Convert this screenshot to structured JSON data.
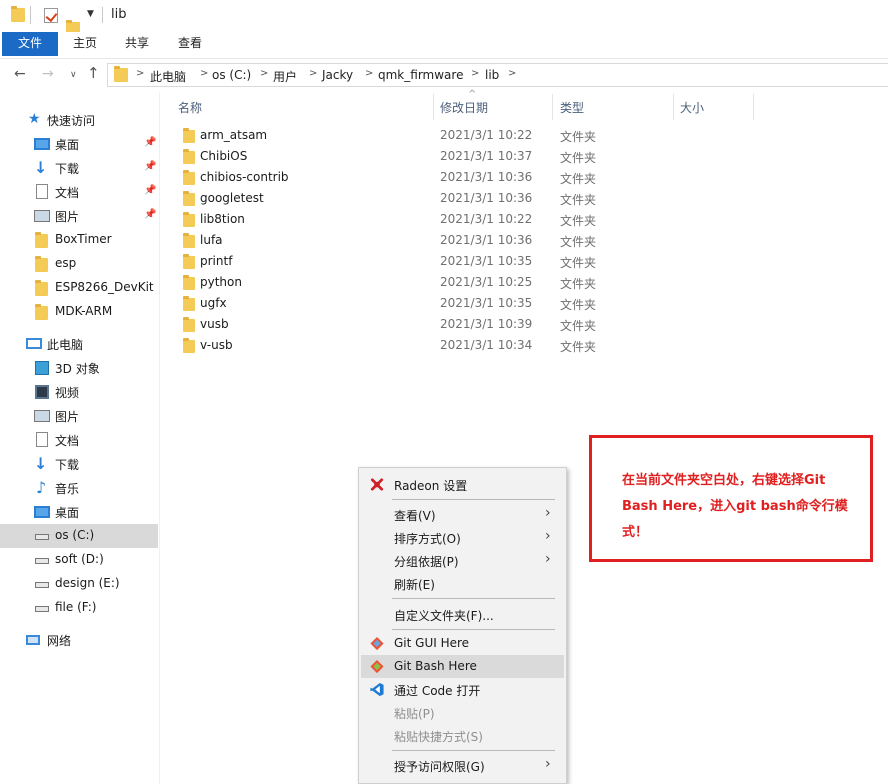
{
  "window": {
    "title": "lib",
    "ribbon_tabs": [
      "文件",
      "主页",
      "共享",
      "查看"
    ]
  },
  "address": {
    "crumbs": [
      "此电脑",
      "os (C:)",
      "用户",
      "Jacky",
      "qmk_firmware",
      "lib"
    ]
  },
  "sidebar": {
    "quick_access": "快速访问",
    "quick_items": [
      {
        "label": "桌面",
        "icon": "desktop-icon",
        "pinned": true
      },
      {
        "label": "下载",
        "icon": "download-icon",
        "pinned": true
      },
      {
        "label": "文档",
        "icon": "document-icon",
        "pinned": true
      },
      {
        "label": "图片",
        "icon": "picture-icon",
        "pinned": true
      },
      {
        "label": "BoxTimer",
        "icon": "folder-icon",
        "pinned": false
      },
      {
        "label": "esp",
        "icon": "folder-icon",
        "pinned": false
      },
      {
        "label": "ESP8266_DevKit",
        "icon": "folder-icon",
        "pinned": false
      },
      {
        "label": "MDK-ARM",
        "icon": "folder-icon",
        "pinned": false
      }
    ],
    "this_pc": "此电脑",
    "pc_items": [
      {
        "label": "3D 对象",
        "icon": "3d-objects-icon"
      },
      {
        "label": "视频",
        "icon": "video-icon"
      },
      {
        "label": "图片",
        "icon": "picture-icon"
      },
      {
        "label": "文档",
        "icon": "document-icon"
      },
      {
        "label": "下载",
        "icon": "download-icon"
      },
      {
        "label": "音乐",
        "icon": "music-icon"
      },
      {
        "label": "桌面",
        "icon": "desktop-icon"
      },
      {
        "label": "os (C:)",
        "icon": "drive-icon",
        "selected": true
      },
      {
        "label": "soft (D:)",
        "icon": "drive-icon"
      },
      {
        "label": "design (E:)",
        "icon": "drive-icon"
      },
      {
        "label": "file (F:)",
        "icon": "drive-icon"
      }
    ],
    "network": "网络"
  },
  "columns": {
    "name": "名称",
    "date": "修改日期",
    "type": "类型",
    "size": "大小"
  },
  "files": [
    {
      "name": "arm_atsam",
      "date": "2021/3/1 10:22",
      "type": "文件夹"
    },
    {
      "name": "ChibiOS",
      "date": "2021/3/1 10:37",
      "type": "文件夹"
    },
    {
      "name": "chibios-contrib",
      "date": "2021/3/1 10:36",
      "type": "文件夹"
    },
    {
      "name": "googletest",
      "date": "2021/3/1 10:36",
      "type": "文件夹"
    },
    {
      "name": "lib8tion",
      "date": "2021/3/1 10:22",
      "type": "文件夹"
    },
    {
      "name": "lufa",
      "date": "2021/3/1 10:36",
      "type": "文件夹"
    },
    {
      "name": "printf",
      "date": "2021/3/1 10:35",
      "type": "文件夹"
    },
    {
      "name": "python",
      "date": "2021/3/1 10:25",
      "type": "文件夹"
    },
    {
      "name": "ugfx",
      "date": "2021/3/1 10:35",
      "type": "文件夹"
    },
    {
      "name": "vusb",
      "date": "2021/3/1 10:39",
      "type": "文件夹"
    },
    {
      "name": "v-usb",
      "date": "2021/3/1 10:34",
      "type": "文件夹"
    }
  ],
  "context_menu": {
    "radeon": "Radeon 设置",
    "view": "查看(V)",
    "sort": "排序方式(O)",
    "group": "分组依据(P)",
    "refresh": "刷新(E)",
    "customize": "自定义文件夹(F)...",
    "git_gui": "Git GUI Here",
    "git_bash": "Git Bash Here",
    "vscode": "通过 Code 打开",
    "paste": "粘贴(P)",
    "paste_shortcut": "粘贴快捷方式(S)",
    "grant_access": "授予访问权限(G)"
  },
  "annotation": {
    "text": "在当前文件夹空白处，右键选择Git Bash Here，进入git bash命令行模式！"
  },
  "colors": {
    "accent": "#1b6ac6",
    "annotation": "#e02020",
    "folder": "#f5cb58"
  }
}
